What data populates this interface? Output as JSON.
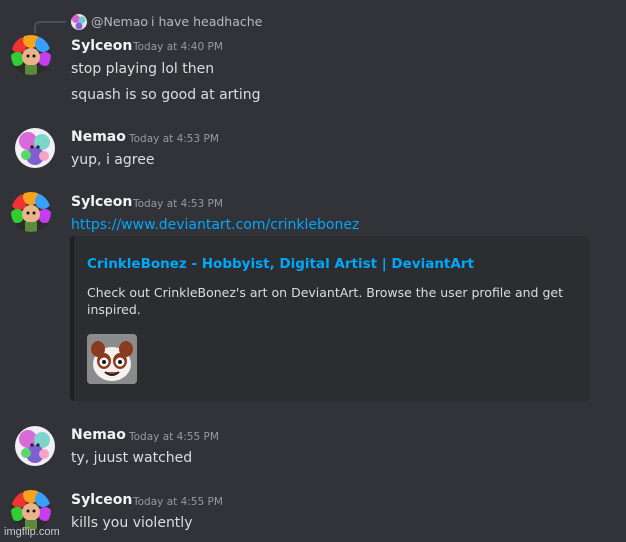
{
  "reply": {
    "author": "@Nemao",
    "text": "i have headhache"
  },
  "messages": [
    {
      "author": "Sylceon",
      "time": "Today at 4:40 PM",
      "lines": [
        "stop playing lol then",
        "squash is so good at arting"
      ]
    },
    {
      "author": "Nemao",
      "time": "Today at 4:53 PM",
      "lines": [
        "yup, i agree"
      ]
    },
    {
      "author": "Sylceon",
      "time": "Today at 4:53 PM",
      "lines": [
        "https://www.deviantart.com/crinklebonez"
      ]
    },
    {
      "author": "Nemao",
      "time": "Today at 4:55 PM",
      "lines": [
        "ty, juust watched"
      ]
    },
    {
      "author": "Sylceon",
      "time": "Today at 4:55 PM",
      "lines": [
        "kills you violently"
      ]
    }
  ],
  "embed": {
    "title": "CrinkleBonez - Hobbyist, Digital Artist | DeviantArt",
    "description": "Check out CrinkleBonez's art on DeviantArt. Browse the user profile and get inspired."
  },
  "watermark": "imgflip.com",
  "colors": {
    "background": "#313338",
    "link": "#00a8fc",
    "embed_bg": "#2b2d31"
  },
  "icons": {
    "sylceon_avatar": "rainbow-haired-character-avatar",
    "nemao_avatar": "colorful-character-avatar",
    "embed_thumbnail": "panda-dog-avatar"
  }
}
